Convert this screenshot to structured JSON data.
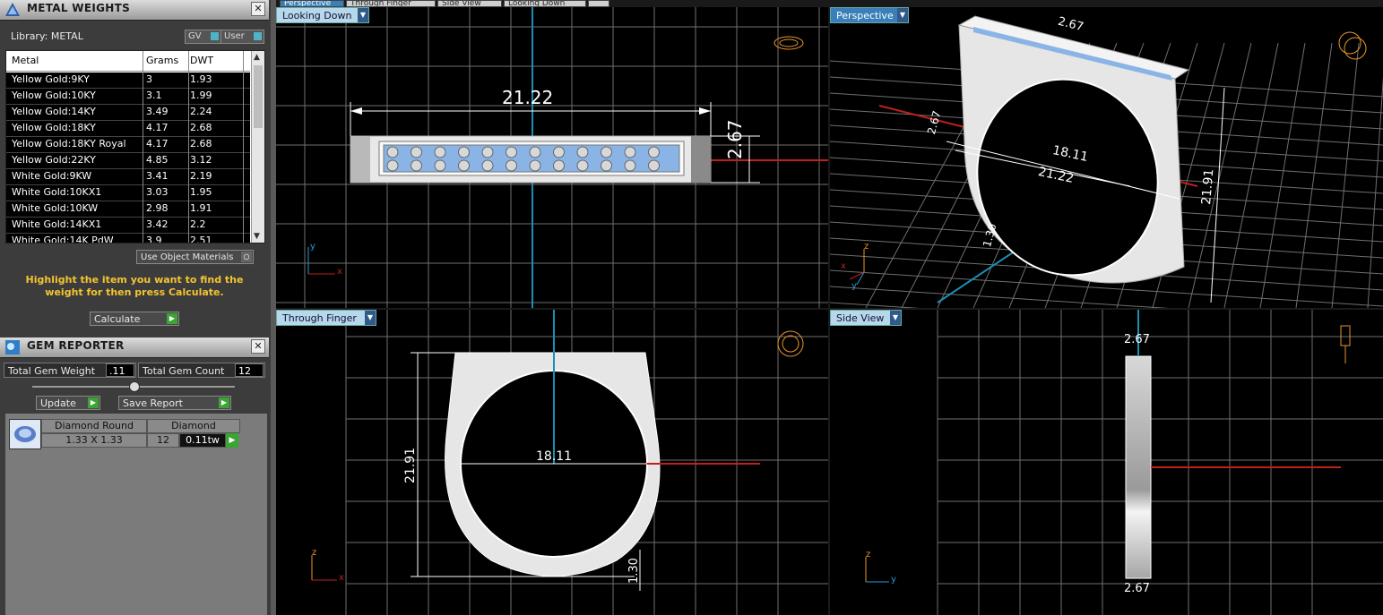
{
  "metal_panel": {
    "title": "METAL WEIGHTS",
    "library_label": "Library: METAL",
    "gv_label": "GV",
    "user_label": "User",
    "columns": [
      "Metal",
      "Grams",
      "DWT"
    ],
    "rows": [
      {
        "metal": "Yellow Gold:9KY",
        "grams": "3",
        "dwt": "1.93"
      },
      {
        "metal": "Yellow Gold:10KY",
        "grams": "3.1",
        "dwt": "1.99"
      },
      {
        "metal": "Yellow Gold:14KY",
        "grams": "3.49",
        "dwt": "2.24"
      },
      {
        "metal": "Yellow Gold:18KY",
        "grams": "4.17",
        "dwt": "2.68"
      },
      {
        "metal": "Yellow Gold:18KY Royal",
        "grams": "4.17",
        "dwt": "2.68"
      },
      {
        "metal": "Yellow Gold:22KY",
        "grams": "4.85",
        "dwt": "3.12"
      },
      {
        "metal": "White Gold:9KW",
        "grams": "3.41",
        "dwt": "2.19"
      },
      {
        "metal": "White Gold:10KX1",
        "grams": "3.03",
        "dwt": "1.95"
      },
      {
        "metal": "White Gold:10KW",
        "grams": "2.98",
        "dwt": "1.91"
      },
      {
        "metal": "White Gold:14KX1",
        "grams": "3.42",
        "dwt": "2.2"
      },
      {
        "metal": "White Gold:14K PdW",
        "grams": "3.9",
        "dwt": "2.51"
      }
    ],
    "use_object_materials": "Use Object Materials",
    "hint": "Highlight the item you want to find the weight for then press Calculate.",
    "calculate": "Calculate"
  },
  "gem_panel": {
    "title": "GEM REPORTER",
    "total_weight_label": "Total Gem Weight",
    "total_weight_value": ".11",
    "total_count_label": "Total Gem Count",
    "total_count_value": "12",
    "update": "Update",
    "save_report": "Save Report",
    "gem": {
      "shape": "Diamond Round",
      "type": "Diamond",
      "size": "1.33 X 1.33",
      "count": "12",
      "weight": "0.11tw"
    }
  },
  "top_tabs": [
    "Perspective",
    "Through Finger",
    "Side View",
    "Looking Down"
  ],
  "viewports": {
    "looking_down": {
      "label": "Looking Down",
      "dim_width": "21.22",
      "dim_height": "2.67",
      "axis_v": "y",
      "axis_h": "x"
    },
    "perspective": {
      "label": "Perspective",
      "dim_top": "2.67",
      "dim_inner": "18.11",
      "dim_width": "21.22",
      "dim_height": "21.91",
      "dim_side": "2.67",
      "dim_thick": "1.30",
      "axis_z": "z",
      "axis_x": "x",
      "axis_y": "y"
    },
    "through_finger": {
      "label": "Through Finger",
      "dim_height": "21.91",
      "dim_inner": "18.11",
      "dim_thick": "1.30",
      "axis_v": "z",
      "axis_h": "x"
    },
    "side_view": {
      "label": "Side View",
      "dim_top": "2.67",
      "dim_bottom": "2.67",
      "axis_v": "z",
      "axis_h": "y"
    }
  },
  "colors": {
    "grid": "#7a7a7a",
    "gem": "#8ab4e6",
    "accent": "#3a7fb8",
    "axis_red": "#c0201d",
    "axis_teal": "#1a8fb3"
  }
}
